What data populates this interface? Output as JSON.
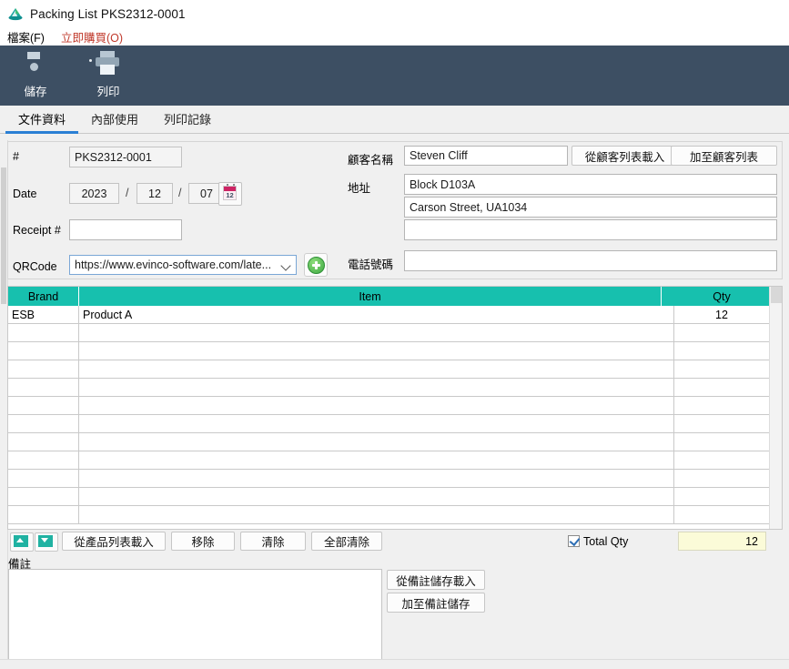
{
  "window": {
    "title": "Packing List PKS2312-0001",
    "logo_icon": "app-logo-icon"
  },
  "menubar": {
    "items": [
      {
        "label": "檔案(F)",
        "name": "menu-file"
      },
      {
        "label": "立即購買(O)",
        "name": "menu-buy-now"
      }
    ]
  },
  "toolbar": {
    "buttons": [
      {
        "label": "儲存",
        "icon": "save-floppy-icon",
        "name": "toolbar-save"
      },
      {
        "label": "列印",
        "icon": "printer-icon",
        "name": "toolbar-print"
      }
    ]
  },
  "tabs": [
    {
      "label": "文件資料",
      "active": true
    },
    {
      "label": "內部使用",
      "active": false
    },
    {
      "label": "列印記錄",
      "active": false
    }
  ],
  "form": {
    "doc_number_label": "#",
    "doc_number_value": "PKS2312-0001",
    "date_label": "Date",
    "date_year": "2023",
    "date_month": "12",
    "date_day": "07",
    "date_sep": "/",
    "calendar_day": "12",
    "receipt_label": "Receipt #",
    "receipt_value": "",
    "qrcode_label": "QRCode",
    "qrcode_value": "https://www.evinco-software.com/late...",
    "customer_name_label": "顧客名稱",
    "customer_name_value": "Steven Cliff",
    "load_customer_button": "從顧客列表載入",
    "add_customer_button": "加至顧客列表",
    "address_label": "地址",
    "address_line1": "Block D103A",
    "address_line2": "Carson Street, UA1034",
    "address_line3": "",
    "phone_label": "電話號碼",
    "phone_value": ""
  },
  "grid": {
    "columns": [
      {
        "key": "brand",
        "label": "Brand"
      },
      {
        "key": "item",
        "label": "Item"
      },
      {
        "key": "qty",
        "label": "Qty"
      }
    ],
    "rows": [
      {
        "brand": "ESB",
        "item": "Product A",
        "qty": "12"
      },
      {
        "brand": "",
        "item": "",
        "qty": ""
      },
      {
        "brand": "",
        "item": "",
        "qty": ""
      },
      {
        "brand": "",
        "item": "",
        "qty": ""
      },
      {
        "brand": "",
        "item": "",
        "qty": ""
      },
      {
        "brand": "",
        "item": "",
        "qty": ""
      },
      {
        "brand": "",
        "item": "",
        "qty": ""
      },
      {
        "brand": "",
        "item": "",
        "qty": ""
      },
      {
        "brand": "",
        "item": "",
        "qty": ""
      },
      {
        "brand": "",
        "item": "",
        "qty": ""
      },
      {
        "brand": "",
        "item": "",
        "qty": ""
      },
      {
        "brand": "",
        "item": "",
        "qty": ""
      }
    ]
  },
  "gridtools": {
    "move_up": "move-up-icon",
    "move_down": "move-down-icon",
    "load_products": "從產品列表載入",
    "remove": "移除",
    "clear": "清除",
    "clear_all": "全部清除",
    "total_qty_label": "Total Qty",
    "total_qty_checked": true,
    "total_qty_value": "12"
  },
  "remarks": {
    "label": "備註",
    "value": "",
    "load_button": "從備註儲存載入",
    "save_button": "加至備註儲存"
  },
  "colors": {
    "toolbar_bg": "#3d4f63",
    "grid_header": "#17c0ae",
    "tab_accent": "#2a7fd4",
    "buy_menu": "#c0392b",
    "total_bg": "#fbfbd8"
  }
}
